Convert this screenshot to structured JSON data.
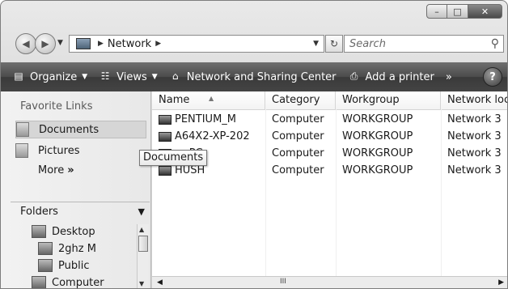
{
  "window": {
    "caption": {
      "minimize": "–",
      "maximize": "□",
      "close": "✕"
    }
  },
  "nav": {
    "address": {
      "location": "Network"
    },
    "search": {
      "placeholder": "Search"
    }
  },
  "toolbar": {
    "organize": "Organize",
    "views": "Views",
    "network_sharing": "Network and Sharing Center",
    "add_printer": "Add a printer",
    "overflow": "»",
    "help": "?"
  },
  "sidebar": {
    "favorites_title": "Favorite Links",
    "favorites": [
      {
        "label": "Documents",
        "selected": true
      },
      {
        "label": "Pictures",
        "selected": false
      }
    ],
    "more": "More",
    "folders_title": "Folders",
    "tree": [
      {
        "label": "Desktop"
      },
      {
        "label": "2ghz M"
      },
      {
        "label": "Public"
      },
      {
        "label": "Computer"
      }
    ]
  },
  "list": {
    "columns": [
      "Name",
      "Category",
      "Workgroup",
      "Network loca"
    ],
    "rows": [
      [
        "PENTIUM_M",
        "Computer",
        "WORKGROUP",
        "Network 3"
      ],
      [
        "A64X2-XP-202",
        "Computer",
        "WORKGROUP",
        "Network 3"
      ],
      [
        "…-PC",
        "Computer",
        "WORKGROUP",
        "Network 3"
      ],
      [
        "HUSH",
        "Computer",
        "WORKGROUP",
        "Network 3"
      ]
    ]
  },
  "tooltip": "Documents",
  "hscroll_grip": "III"
}
